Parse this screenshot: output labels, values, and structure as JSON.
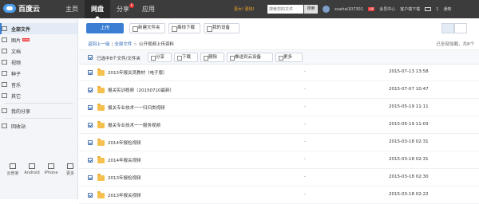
{
  "header": {
    "logo": "百度云",
    "nav": [
      "主页",
      "网盘",
      "分享",
      "应用"
    ],
    "share_badge": "6",
    "promo": "更大! 更快!",
    "search_placeholder": "搜索您的文件",
    "search_button": "搜索",
    "username": "xuehai107301",
    "vip": "VIP",
    "links": [
      "会员中心",
      "客户端下载",
      "通知"
    ],
    "mail_count": "1"
  },
  "sidebar": {
    "items": [
      {
        "label": "全部文件",
        "icon": "folder-icon"
      },
      {
        "label": "图片",
        "icon": "image-icon",
        "tag": "new"
      },
      {
        "label": "文档",
        "icon": "document-icon"
      },
      {
        "label": "视频",
        "icon": "video-icon"
      },
      {
        "label": "种子",
        "icon": "torrent-icon"
      },
      {
        "label": "音乐",
        "icon": "music-icon"
      },
      {
        "label": "其它",
        "icon": "other-icon"
      }
    ],
    "share": "我的分享",
    "recycle": "回收站",
    "devices": [
      "云管家",
      "Android",
      "iPhone",
      "更多"
    ]
  },
  "toolbar": {
    "upload": "上传",
    "new_folder": "新建文件夹",
    "offline": "离线下载",
    "my_devices": "我的设备"
  },
  "breadcrumb": {
    "back": "返回上一级",
    "all": "全部文件",
    "current": "公开视频上传资料",
    "loaded": "已全部加载，共8个"
  },
  "selection": {
    "text": "已选中8个文件/文件夹",
    "buttons": [
      "分享",
      "下载",
      "删除",
      "推送到云设备",
      "更多"
    ]
  },
  "files": [
    {
      "name": "2015年报关员教材（电子版）",
      "size": "-",
      "date": "2015-07-13 13:58"
    },
    {
      "name": "报关实训视频（20150710最新）",
      "size": "-",
      "date": "2015-07-07 10:47"
    },
    {
      "name": "报关专业技术一一归归类视频",
      "size": "-",
      "date": "2015-05-19 11:11"
    },
    {
      "name": "报关专业技术一一服务视频",
      "size": "-",
      "date": "2015-05-19 11:03"
    },
    {
      "name": "2014年报检视频",
      "size": "-",
      "date": "2015-03-18 02:31"
    },
    {
      "name": "2014年报关视频",
      "size": "-",
      "date": "2015-03-18 02:31"
    },
    {
      "name": "2013年报检视频",
      "size": "-",
      "date": "2015-03-18 02:30"
    },
    {
      "name": "2013年报关视频",
      "size": "-",
      "date": "2015-03-18 02:22"
    }
  ]
}
